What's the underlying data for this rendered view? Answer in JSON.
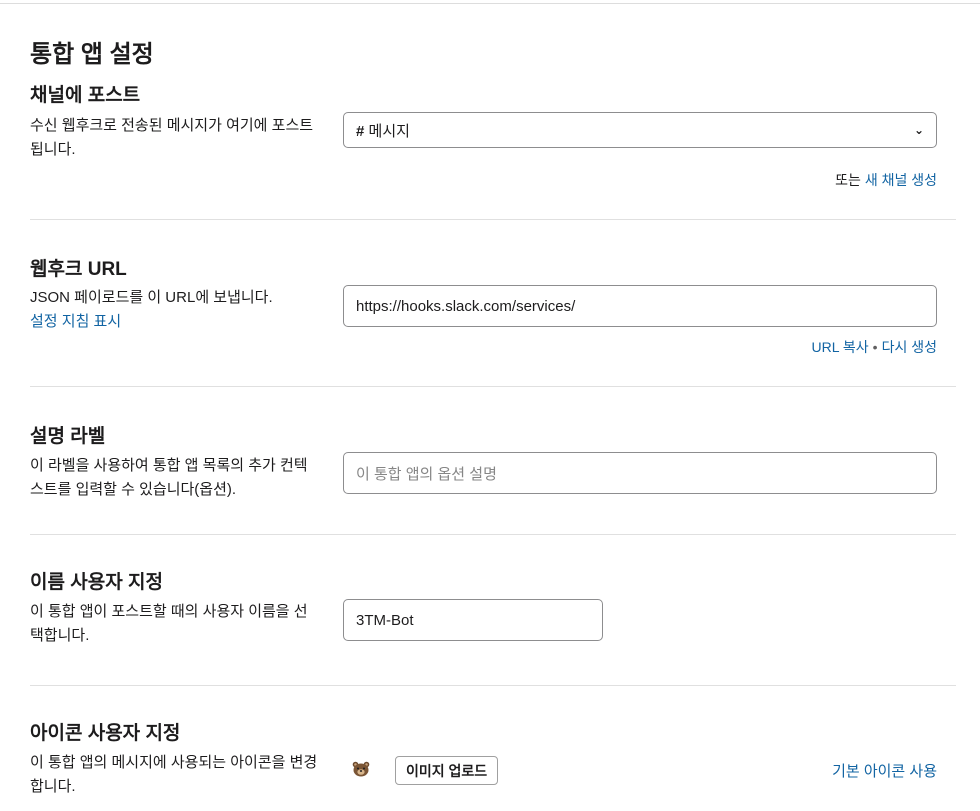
{
  "page_title": "통합 앱 설정",
  "channel": {
    "title": "채널에 포스트",
    "desc": "수신 웹후크로 전송된 메시지가 여기에 포스트됩니다.",
    "selected": "메시지",
    "or_text": "또는",
    "create_link": "새 채널 생성"
  },
  "webhook": {
    "title": "웹후크 URL",
    "desc": "JSON 페이로드를 이 URL에 보냅니다.",
    "guide_link": "설정 지침 표시",
    "url_value": "https://hooks.slack.com/services/",
    "copy_link": "URL 복사",
    "regen_link": "다시 생성"
  },
  "label": {
    "title": "설명 라벨",
    "desc": "이 라벨을 사용하여 통합 앱 목록의 추가 컨텍스트를 입력할 수 있습니다(옵션).",
    "placeholder": "이 통합 앱의 옵션 설명"
  },
  "name": {
    "title": "이름 사용자 지정",
    "desc": "이 통합 앱이 포스트할 때의 사용자 이름을 선택합니다.",
    "value": "3TM-Bot"
  },
  "icon": {
    "title": "아이콘 사용자 지정",
    "desc": "이 통합 앱의 메시지에 사용되는 아이콘을 변경합니다.",
    "upload_label": "이미지 업로드",
    "default_link": "기본 아이콘 사용",
    "icon_name": "bear-icon"
  },
  "colors": {
    "link": "#1264a3",
    "text": "#1d1c1d"
  }
}
